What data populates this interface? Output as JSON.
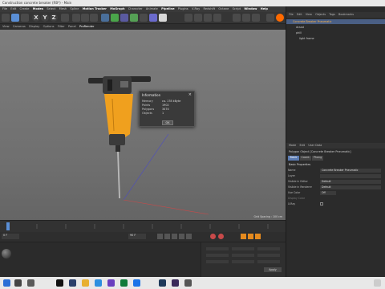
{
  "window": {
    "title": "Construction concrete breaker (RB*) - Main"
  },
  "menubar": {
    "items": [
      "File",
      "Edit",
      "Create",
      "Modes",
      "Select",
      "Mesh",
      "Spline",
      "Motion Tracker",
      "MoGraph",
      "Character",
      "Animate",
      "Pipeline",
      "Plugins",
      "V-Ray",
      "Redshift",
      "Octane",
      "Script",
      "Window",
      "Help"
    ]
  },
  "toolbar": {
    "axes": [
      "X",
      "Y",
      "Z"
    ]
  },
  "viewport": {
    "menu": [
      "View",
      "Cameras",
      "Display",
      "Options",
      "Filter",
      "Panel",
      "ProRender"
    ],
    "grid_spacing": "Grid Spacing : 100 cm"
  },
  "dialog": {
    "title": "Information",
    "rows": [
      {
        "label": "Memory",
        "value": "ca. 178 kByte"
      },
      {
        "label": "Points",
        "value": "1902"
      },
      {
        "label": "Polygons",
        "value": "3474"
      },
      {
        "label": "Objects",
        "value": "1"
      }
    ],
    "ok_label": "OK"
  },
  "timeline": {
    "frame": "0 F",
    "end": "90 F"
  },
  "object_manager": {
    "menu": [
      "File",
      "Edit",
      "View",
      "Objects",
      "Tags",
      "Bookmarks"
    ],
    "objects": [
      "Concrete Breaker Pneumatic",
      "draad",
      "phill",
      "light frame"
    ]
  },
  "attribute_manager": {
    "menu": [
      "Mode",
      "Edit",
      "User Data"
    ],
    "header": "Polygon Object [Concrete Breaker Pneumatic]",
    "tabs": [
      "Basic",
      "Coord.",
      "Phong"
    ],
    "section": "Basic Properties",
    "rows": [
      {
        "label": "Name",
        "value": "Concrete Breaker Pneumatic"
      },
      {
        "label": "Layer",
        "value": ""
      },
      {
        "label": "Visible in Editor",
        "value": "Default"
      },
      {
        "label": "Visible in Renderer",
        "value": "Default"
      },
      {
        "label": "Use Color",
        "value": "Off"
      },
      {
        "label": "Display Color",
        "value": ""
      },
      {
        "label": "X-Ray",
        "value": ""
      }
    ]
  },
  "coords": {
    "apply_label": "Apply"
  },
  "colors": {
    "accent": "#f0a01e",
    "select": "#5a7ab0"
  }
}
